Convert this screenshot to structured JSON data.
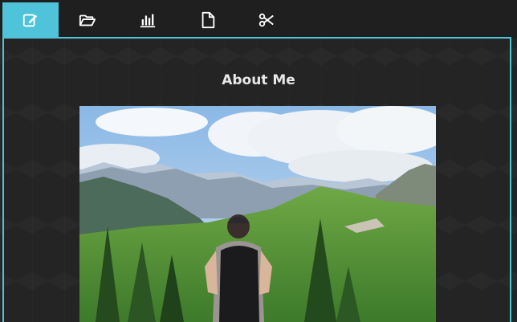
{
  "tabs": [
    {
      "icon": "edit-icon",
      "active": true
    },
    {
      "icon": "folder-open-icon",
      "active": false
    },
    {
      "icon": "bar-chart-icon",
      "active": false
    },
    {
      "icon": "file-icon",
      "active": false
    },
    {
      "icon": "scissors-icon",
      "active": false
    }
  ],
  "content": {
    "title": "About Me",
    "photo_description_icon": "landscape-photo"
  },
  "colors": {
    "accent": "#4fc3da",
    "background": "#242425",
    "tabbar": "#1f1f20",
    "title_text": "#e8e8e8"
  }
}
